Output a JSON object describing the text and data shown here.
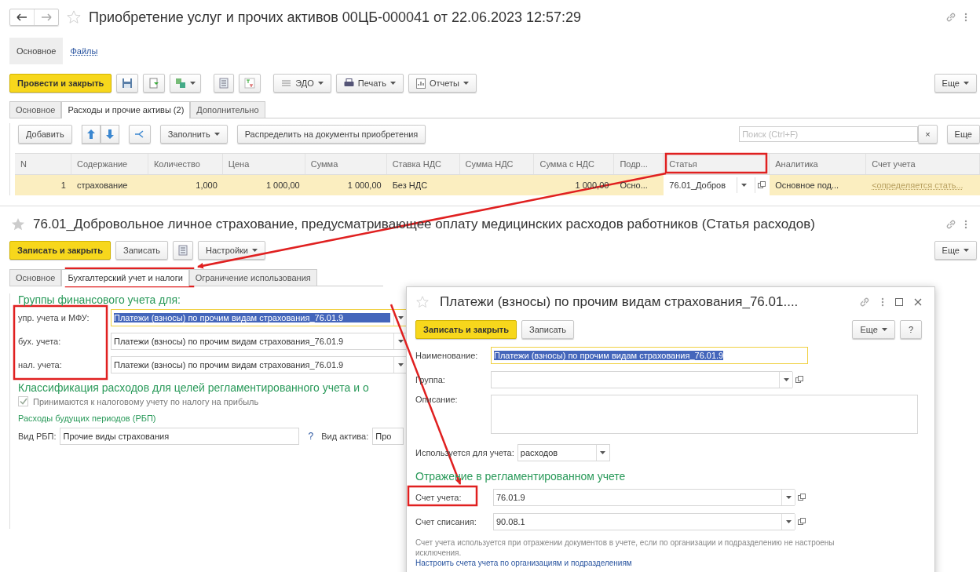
{
  "document": {
    "title": "Приобретение услуг и прочих активов 00ЦБ-000041 от 22.06.2023 12:57:29",
    "nav": [
      {
        "label": "Основное",
        "selected": true
      },
      {
        "label": "Файлы",
        "selected": false
      }
    ],
    "toolbar": {
      "primary": "Провести и закрыть",
      "menus": [
        "ЭДО",
        "Печать",
        "Отчеты"
      ],
      "more": "Еще"
    },
    "tabs": [
      {
        "label": "Основное",
        "selected": false
      },
      {
        "label": "Расходы и прочие активы (2)",
        "selected": true
      },
      {
        "label": "Дополнительно",
        "selected": false
      }
    ],
    "table_toolbar": {
      "add": "Добавить",
      "fill": "Заполнить",
      "distribute": "Распределить на документы приобретения",
      "search": {
        "placeholder": "Поиск (Ctrl+F)"
      },
      "clear": "×",
      "more": "Еще"
    },
    "table": {
      "columns": [
        "N",
        "Содержание",
        "Количество",
        "Цена",
        "Сумма",
        "Ставка НДС",
        "Сумма НДС",
        "Сумма с НДС",
        "Подр...",
        "Статья",
        "Аналитика",
        "Счет учета"
      ],
      "rows": [
        {
          "selected": true,
          "cells": [
            "1",
            "страхование",
            "1,000",
            "1 000,00",
            "1 000,00",
            "Без НДС",
            null,
            "1 000,00",
            "Осно...",
            "76.01_Добров",
            "Основное под...",
            "<определяется стать..."
          ]
        }
      ]
    }
  },
  "item_window": {
    "title": "76.01_Добровольное личное страхование, предусматривающее  оплату медицинских расходов работников (Статья расходов)",
    "buttons": {
      "primary": "Записать и закрыть",
      "save": "Записать",
      "settings": "Настройки",
      "more": "Еще"
    },
    "tabs": [
      {
        "label": "Основное",
        "selected": false
      },
      {
        "label": "Бухгалтерский учет и налоги",
        "selected": true
      },
      {
        "label": "Ограничение использования",
        "selected": false
      }
    ],
    "groups_heading": "Группы финансового учета для:",
    "group_fields": [
      {
        "label": "упр. учета и МФУ:",
        "value": "Платежи (взносы) по прочим видам страхования_76.01.9",
        "selected": true
      },
      {
        "label": "бух. учета:",
        "value": "Платежи (взносы) по прочим видам страхования_76.01.9",
        "selected": false
      },
      {
        "label": "нал. учета:",
        "value": "Платежи (взносы) по прочим видам страхования_76.01.9",
        "selected": false
      }
    ],
    "classification_heading": "Классификация расходов для целей регламентированного учета и о",
    "tax_checkbox": {
      "label": "Принимаются к налоговому учету по налогу на прибыль",
      "checked": true,
      "disabled": true
    },
    "rbp_heading": "Расходы будущих периодов (РБП)",
    "rbp_kind": {
      "label": "Вид РБП:",
      "value": "Прочие виды страхования",
      "help": "?"
    },
    "asset_kind": {
      "label": "Вид актива:",
      "value": "Про"
    }
  },
  "dialog": {
    "title": "Платежи (взносы) по прочим видам страхования_76.01....",
    "buttons": {
      "primary": "Записать и закрыть",
      "save": "Записать",
      "more": "Еще",
      "help": "?"
    },
    "name": {
      "label": "Наименование:",
      "value": "Платежи (взносы) по прочим видам страхования_76.01.9"
    },
    "group": {
      "label": "Группа:"
    },
    "description": {
      "label": "Описание:"
    },
    "usage": {
      "label": "Используется для учета:",
      "value": "расходов"
    },
    "section_heading": "Отражение в регламентированном учете",
    "accounts": [
      {
        "label": "Счет учета:",
        "value": "76.01.9"
      },
      {
        "label": "Счет списания:",
        "value": "90.08.1"
      }
    ],
    "note": "Счет учета используется при отражении документов в учете, если по организации и подразделению не настроены исключения.",
    "link": "Настроить счета учета по организациям и подразделениям"
  }
}
